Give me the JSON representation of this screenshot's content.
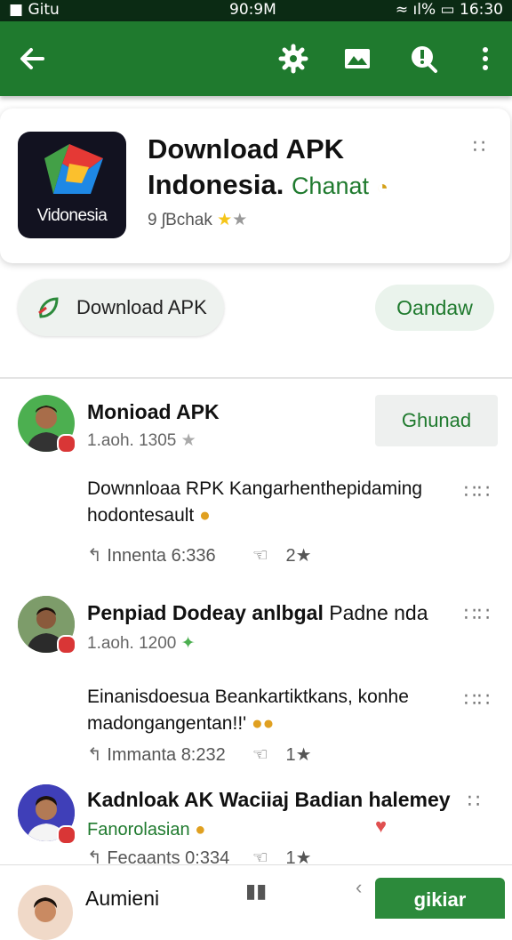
{
  "status_bar": {
    "left": "Gitu",
    "time_center": "90:9M",
    "signal": "ıl%",
    "clock": "16:30"
  },
  "app_bar": {
    "icons": [
      "back-arrow-icon",
      "gear-icon",
      "image-icon",
      "search-alert-icon",
      "more-vert-icon"
    ]
  },
  "app_card": {
    "logo_label": "Vidonesia",
    "title_line1": "Download APK",
    "title_line2": "Indonesia.",
    "title_suffix": "Chanat",
    "rating_text": "9 ʃBchak"
  },
  "actions": {
    "primary_label": "Download APK",
    "secondary_label": "Oandaw"
  },
  "comments": [
    {
      "name": "Monioad APK",
      "meta": "1.aoh. 1305",
      "follow_label": "Ghunad",
      "text_line1": "Downnloaa RPK Kangarhenthepidaming",
      "text_line2": "hodontesault",
      "time": "Innenta 6:336",
      "likes": "2"
    },
    {
      "name": "Penpiad Dodeay anlbgal",
      "name_suffix": "Padne nda",
      "meta": "1.aoh. 1200",
      "text_line1": "Einanisdoesua Beankartiktkans, konhe",
      "text_line2": "madongangentan!!'",
      "time": "Immanta 8:232",
      "likes": "1"
    },
    {
      "name": "Kadnloak AK Waciiaj Badian halemey",
      "sub": "Fanorolasian",
      "time": "Fecaants 0:334",
      "likes": "1"
    }
  ],
  "bottom_bar": {
    "name": "Aumieni",
    "button_label": "gikiar"
  },
  "colors": {
    "primary": "#1f7a2e",
    "dark_status": "#0b2b14",
    "star": "#f5c518"
  }
}
